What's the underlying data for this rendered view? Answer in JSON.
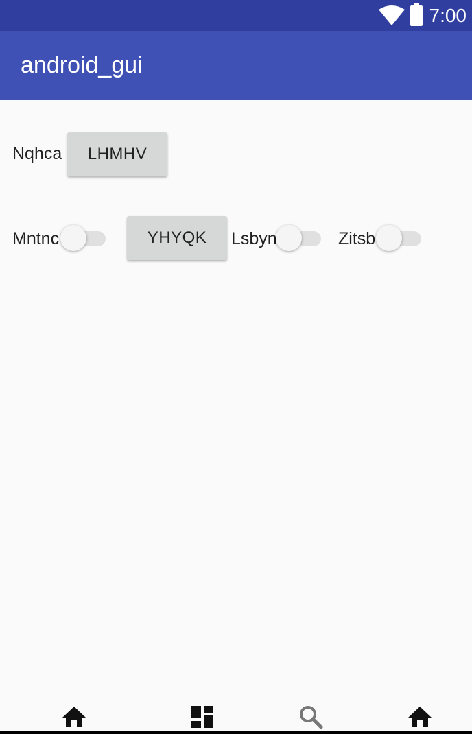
{
  "status_bar": {
    "time": "7:00",
    "icons": [
      "wifi-icon",
      "battery-icon"
    ]
  },
  "app_bar": {
    "title": "android_gui"
  },
  "row1": {
    "label": "Nqhca",
    "button_label": "LHMHV"
  },
  "row2": {
    "switch1_label": "Mntnc",
    "switch1_on": false,
    "button_label": "YHYQK",
    "switch2_label": "Lsbyn",
    "switch2_on": false,
    "switch3_label": "Zitsb",
    "switch3_on": false
  },
  "bottom_nav": {
    "icons": [
      "home-icon",
      "dashboard-icon",
      "search-icon",
      "home-icon"
    ]
  },
  "colors": {
    "status_bar": "#303f9f",
    "app_bar": "#3f51b5",
    "background": "#fafafa",
    "button": "#d6d7d7"
  }
}
